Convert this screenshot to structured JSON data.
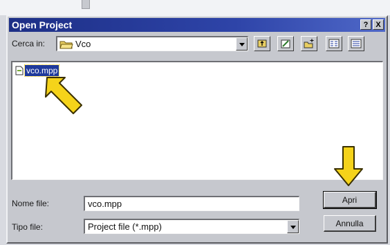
{
  "dialog": {
    "title": "Open Project",
    "help_label": "?",
    "close_label": "X"
  },
  "lookin": {
    "label": "Cerca in:",
    "value": "Vco"
  },
  "toolbar": [
    "up-folder-icon",
    "recent-folder-icon",
    "new-folder-icon",
    "list-view-icon",
    "details-view-icon"
  ],
  "files": [
    {
      "name": "vco.mpp"
    }
  ],
  "filename": {
    "label": "Nome file:",
    "value": "vco.mpp"
  },
  "filetype": {
    "label": "Tipo file:",
    "value": "Project file (*.mpp)"
  },
  "buttons": {
    "open": "Apri",
    "cancel": "Annulla"
  },
  "colors": {
    "titlebar": "#1d2f86",
    "selection": "#1f3a9c",
    "arrow": "#f5d31a"
  }
}
